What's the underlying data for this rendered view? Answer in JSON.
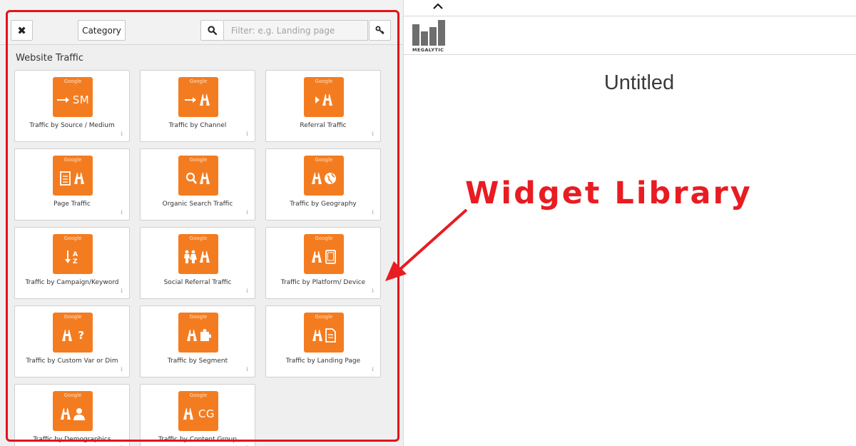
{
  "toolbar": {
    "close_icon": "close-x-icon",
    "category_label": "Category",
    "search_icon": "magnifier-icon",
    "filter_placeholder": "Filter: e.g. Landing page",
    "key_icon": "key-icon"
  },
  "library": {
    "section_title": "Website Traffic",
    "accent_color": "#f47c20",
    "widgets": [
      {
        "brand": "Google",
        "glyph": "→ SM",
        "icon": "arrow-sm-icon",
        "label": "Traffic by Source / Medium",
        "info": "ℹ"
      },
      {
        "brand": "Google",
        "glyph": "→",
        "icon": "arrow-road-icon",
        "label": "Traffic by Channel",
        "info": "ℹ"
      },
      {
        "brand": "Google",
        "glyph": "",
        "icon": "referral-road-icon",
        "label": "Referral Traffic",
        "info": "ℹ"
      },
      {
        "brand": "Google",
        "glyph": "",
        "icon": "page-road-icon",
        "label": "Page Traffic",
        "info": "ℹ"
      },
      {
        "brand": "Google",
        "glyph": "",
        "icon": "search-road-icon",
        "label": "Organic Search Traffic",
        "info": "ℹ"
      },
      {
        "brand": "Google",
        "glyph": "",
        "icon": "road-globe-icon",
        "label": "Traffic by Geography",
        "info": "ℹ"
      },
      {
        "brand": "Google",
        "glyph": "",
        "icon": "sort-az-icon",
        "label": "Traffic by Campaign/Keyword",
        "info": "ℹ"
      },
      {
        "brand": "Google",
        "glyph": "",
        "icon": "people-road-icon",
        "label": "Social Referral Traffic",
        "info": "ℹ"
      },
      {
        "brand": "Google",
        "glyph": "",
        "icon": "road-tablet-icon",
        "label": "Traffic by Platform/ Device",
        "info": "ℹ"
      },
      {
        "brand": "Google",
        "glyph": "?",
        "icon": "road-question-icon",
        "label": "Traffic by Custom Var or Dim",
        "info": "ℹ"
      },
      {
        "brand": "Google",
        "glyph": "",
        "icon": "road-puzzle-icon",
        "label": "Traffic by Segment",
        "info": "ℹ"
      },
      {
        "brand": "Google",
        "glyph": "",
        "icon": "road-page-icon",
        "label": "Traffic by Landing Page",
        "info": "ℹ"
      },
      {
        "brand": "Google",
        "glyph": "",
        "icon": "road-person-icon",
        "label": "Traffic by Demographics",
        "info": "ℹ"
      },
      {
        "brand": "Google",
        "glyph": "CG",
        "icon": "road-cg-icon",
        "label": "Traffic by Content Group",
        "info": "ℹ"
      }
    ]
  },
  "annotation": {
    "text": "Widget Library",
    "color": "#e81c23"
  },
  "editor": {
    "collapse_icon": "chevron-up-icon",
    "logo_text": "MEGALYTIC",
    "title": "Untitled"
  }
}
